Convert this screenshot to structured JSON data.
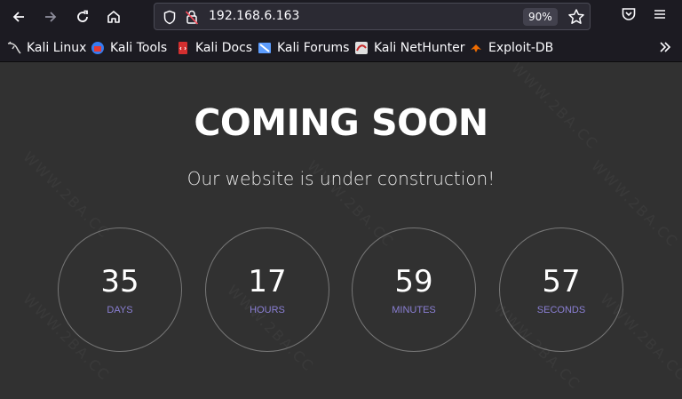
{
  "browser": {
    "url": "192.168.6.163",
    "zoom": "90%",
    "bookmarks": [
      {
        "label": "Kali Linux"
      },
      {
        "label": "Kali Tools"
      },
      {
        "label": "Kali Docs"
      },
      {
        "label": "Kali Forums"
      },
      {
        "label": "Kali NetHunter"
      },
      {
        "label": "Exploit-DB"
      }
    ]
  },
  "page": {
    "title": "COMING SOON",
    "subtitle": "Our website is under construction!",
    "countdown": [
      {
        "value": "35",
        "unit": "DAYS"
      },
      {
        "value": "17",
        "unit": "HOURS"
      },
      {
        "value": "59",
        "unit": "MINUTES"
      },
      {
        "value": "57",
        "unit": "SECONDS"
      }
    ]
  },
  "colors": {
    "page_bg": "#313131",
    "unit_label": "#8a7fd4",
    "circle_border": "#777777"
  }
}
